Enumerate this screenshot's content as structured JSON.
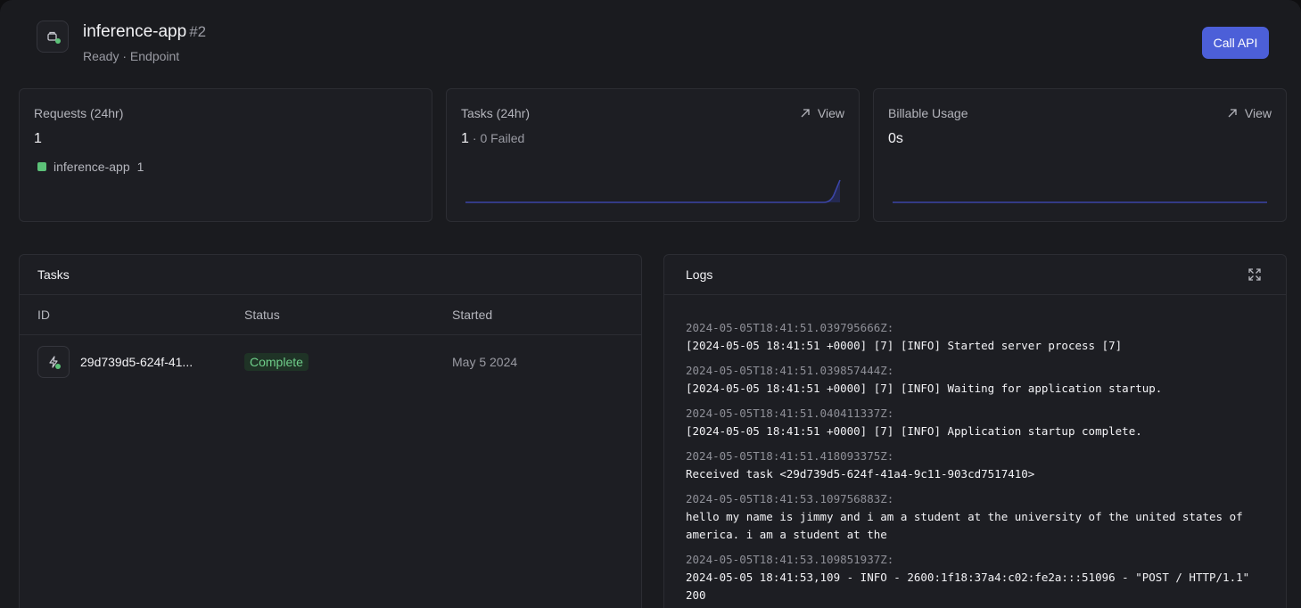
{
  "header": {
    "app_name": "inference-app",
    "app_number": "#2",
    "subtitle": "Ready · Endpoint",
    "call_api_label": "Call API"
  },
  "cards": {
    "requests": {
      "label": "Requests (24hr)",
      "value": "1",
      "legend_name": "inference-app",
      "legend_count": "1"
    },
    "tasks": {
      "label": "Tasks (24hr)",
      "value": "1",
      "sub": "· 0 Failed",
      "view_label": "View"
    },
    "billing": {
      "label": "Billable Usage",
      "value": "0s",
      "view_label": "View"
    }
  },
  "tasks_panel": {
    "title": "Tasks",
    "columns": [
      "ID",
      "Status",
      "Started"
    ],
    "rows": [
      {
        "id": "29d739d5-624f-41...",
        "status": "Complete",
        "started": "May 5 2024"
      }
    ]
  },
  "logs_panel": {
    "title": "Logs",
    "entries": [
      {
        "ts": "2024-05-05T18:41:51.039795666Z:",
        "msg": "[2024-05-05 18:41:51 +0000] [7] [INFO] Started server process [7]"
      },
      {
        "ts": "2024-05-05T18:41:51.039857444Z:",
        "msg": "[2024-05-05 18:41:51 +0000] [7] [INFO] Waiting for application startup."
      },
      {
        "ts": "2024-05-05T18:41:51.040411337Z:",
        "msg": "[2024-05-05 18:41:51 +0000] [7] [INFO] Application startup complete."
      },
      {
        "ts": "2024-05-05T18:41:51.418093375Z:",
        "msg": "Received task <29d739d5-624f-41a4-9c11-903cd7517410>"
      },
      {
        "ts": "2024-05-05T18:41:53.109756883Z:",
        "msg": "hello my name is jimmy and i am a student at the university of the united states of america. i am a student at the"
      },
      {
        "ts": "2024-05-05T18:41:53.109851937Z:",
        "msg": "2024-05-05 18:41:53,109 - INFO - 2600:1f18:37a4:c02:fe2a:::51096 - \"POST / HTTP/1.1\" 200"
      }
    ]
  },
  "colors": {
    "accent": "#4c5fd8",
    "success": "#5cc178",
    "chart_line": "#3b45a8"
  },
  "icons": {
    "app": "cube-icon",
    "view": "arrow-up-right-icon",
    "expand": "expand-icon",
    "task": "lightning-icon"
  }
}
